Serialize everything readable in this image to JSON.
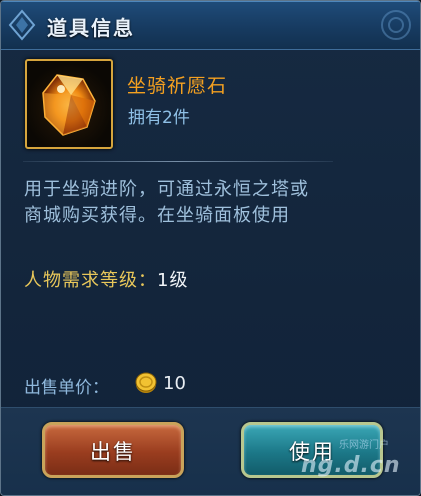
{
  "header": {
    "title": "道具信息"
  },
  "item": {
    "icon": "gem-icon",
    "name": "坐骑祈愿石",
    "count_text": "拥有2件"
  },
  "description": {
    "text": "用于坐骑进阶，可通过永恒之塔或商城购买获得。在坐骑面板使用"
  },
  "requirement": {
    "label": "人物需求等级：",
    "value": "1级"
  },
  "price": {
    "label": "出售单价：",
    "icon": "gold-coin-icon",
    "value": "10"
  },
  "buttons": {
    "sell_label": "出售",
    "use_label": "使用"
  },
  "watermark": {
    "tag": "乐网游门户",
    "text": "ng.d.cn"
  },
  "colors": {
    "item_name": "#f4a020",
    "requirement_label": "#e8c75a",
    "sell_button": "#9a3d1f",
    "use_button": "#1c7888"
  }
}
